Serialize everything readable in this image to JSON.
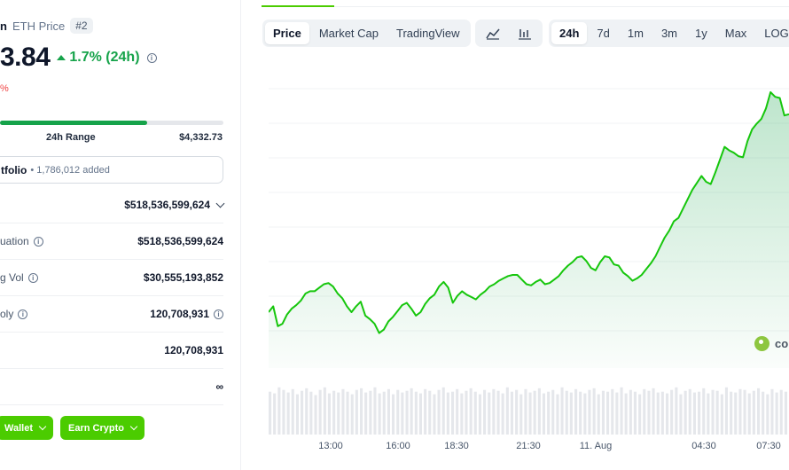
{
  "coin": {
    "name_partial": "n",
    "ticker_label": "ETH Price",
    "rank": "#2"
  },
  "price": {
    "value_partial": "3.84",
    "change": "1.7% (24h)",
    "secondary_change_partial": "%"
  },
  "range": {
    "label": "24h Range",
    "high": "$4,332.73",
    "fill_fraction": 0.66
  },
  "portfolio": {
    "label_partial": "tfolio",
    "count": "• 1,786,012 added"
  },
  "stats": [
    {
      "label": "",
      "value": "$518,536,599,624",
      "has_chevron": true,
      "has_info": false
    },
    {
      "label": "uation",
      "value": "$518,536,599,624",
      "has_chevron": false,
      "has_info": true
    },
    {
      "label": "g Vol",
      "value": "$30,555,193,852",
      "has_chevron": false,
      "has_info": true
    },
    {
      "label": "oly",
      "value": "120,708,931",
      "has_chevron": false,
      "has_info": true,
      "value_info": true
    },
    {
      "label": "",
      "value": "120,708,931",
      "has_chevron": false,
      "has_info": false
    },
    {
      "label": "",
      "value": "∞",
      "has_chevron": false,
      "has_info": false
    }
  ],
  "buttons": {
    "wallet": "Wallet",
    "earn": "Earn Crypto"
  },
  "chart_tabs": {
    "price": "Price",
    "market_cap": "Market Cap",
    "tradingview": "TradingView"
  },
  "chart_types": {
    "line": "line-chart-icon",
    "candle": "candlestick-icon"
  },
  "ranges": {
    "r24h": "24h",
    "r7d": "7d",
    "r1m": "1m",
    "r3m": "3m",
    "r1y": "1y",
    "rmax": "Max",
    "log": "LOG"
  },
  "watermark": "co",
  "colors": {
    "accent": "#4bcc00",
    "up": "#16a34a",
    "down": "#ef4444"
  },
  "chart_data": {
    "type": "area",
    "x_tick_labels": [
      "13:00",
      "16:00",
      "18:30",
      "21:30",
      "11. Aug",
      "04:30",
      "07:30"
    ],
    "series": [
      {
        "values": [
          48,
          53,
          36,
          38,
          46,
          51,
          54,
          58,
          64,
          66,
          66,
          69,
          72,
          73,
          70,
          64,
          60,
          53,
          48,
          53,
          57,
          45,
          42,
          38,
          30,
          33,
          40,
          44,
          49,
          54,
          56,
          51,
          45,
          48,
          55,
          60,
          63,
          70,
          74,
          69,
          56,
          62,
          66,
          63,
          61,
          59,
          63,
          66,
          70,
          72,
          75,
          77,
          79,
          80,
          80,
          76,
          72,
          71,
          74,
          76,
          72,
          73,
          76,
          79,
          84,
          88,
          91,
          95,
          96,
          92,
          86,
          84,
          91,
          96,
          95,
          89,
          88,
          82,
          79,
          75,
          77,
          80,
          85,
          90,
          96,
          104,
          112,
          118,
          126,
          129,
          137,
          145,
          153,
          159,
          165,
          160,
          158,
          168,
          179,
          190,
          187,
          185,
          182,
          181,
          195,
          205,
          210,
          214,
          223,
          237,
          233,
          232,
          217,
          218
        ],
        "ylim": [
          0,
          240
        ]
      }
    ],
    "volume": [
      50,
      48,
      55,
      52,
      49,
      53,
      47,
      51,
      54,
      50,
      46,
      52,
      55,
      48,
      51,
      49,
      53,
      50,
      47,
      52,
      54,
      49,
      51,
      55,
      48,
      50,
      53,
      47,
      52,
      49,
      51,
      54,
      50,
      48,
      53,
      51,
      47,
      52,
      55,
      49,
      50,
      53,
      48,
      51,
      54,
      50,
      47,
      52,
      49,
      53,
      51,
      48,
      55,
      50,
      52,
      47,
      53,
      49,
      51,
      54,
      48,
      50,
      52,
      47,
      55,
      51,
      49,
      53,
      50,
      48,
      52,
      54,
      47,
      51,
      50,
      53,
      49,
      55,
      48,
      52,
      50,
      47,
      53,
      51,
      54,
      49,
      50,
      48,
      52,
      55,
      47,
      51,
      53,
      49,
      50,
      54,
      48,
      52,
      51,
      47,
      55,
      50,
      49,
      53,
      52,
      48,
      51,
      54,
      50,
      47,
      53,
      49,
      52,
      50
    ]
  }
}
